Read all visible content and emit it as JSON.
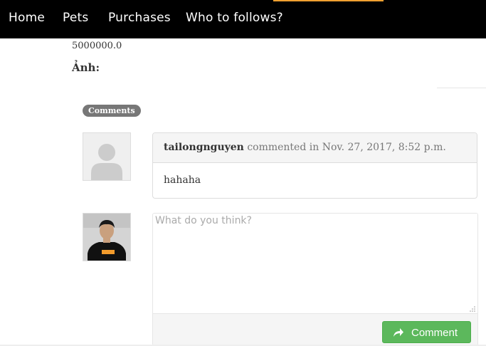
{
  "nav": {
    "items": [
      "Home",
      "Pets",
      "Purchases",
      "Who to follows?"
    ],
    "accent_color": "#f0a030"
  },
  "pet": {
    "price": "5000000.0",
    "photo_label": "Ảnh:"
  },
  "comments": {
    "badge": "Comments",
    "items": [
      {
        "user": "tailongnguyen",
        "meta": "commented in Nov. 27, 2017, 8:52 p.m.",
        "text": "hahaha",
        "avatar": "default-user-icon"
      }
    ]
  },
  "reply": {
    "placeholder": "What do you think?",
    "value": "",
    "button_label": "Comment",
    "button_icon": "share-arrow-icon",
    "button_color": "#5cb85c",
    "avatar": "user-photo"
  }
}
